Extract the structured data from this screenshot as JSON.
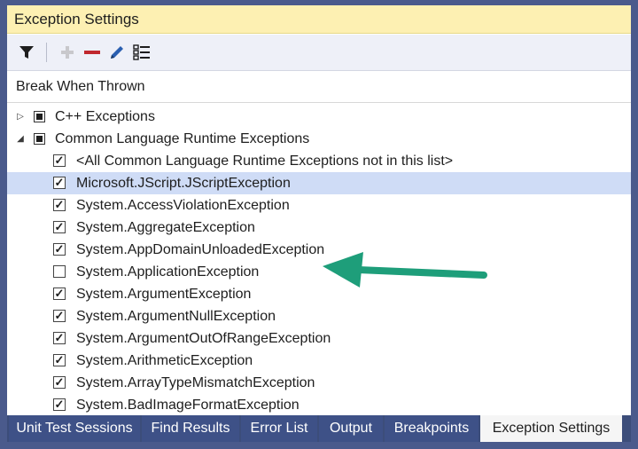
{
  "window": {
    "title": "Exception Settings"
  },
  "toolbar": {
    "buttons": [
      {
        "icon": "filter-icon"
      },
      {
        "icon": "add-icon"
      },
      {
        "icon": "remove-icon"
      },
      {
        "icon": "edit-icon"
      },
      {
        "icon": "restore-list-icon"
      }
    ]
  },
  "header": {
    "column": "Break When Thrown"
  },
  "tree": {
    "categories": [
      {
        "label": "C++ Exceptions",
        "expanded": false
      },
      {
        "label": "Common Language Runtime Exceptions",
        "expanded": true
      }
    ],
    "items": [
      {
        "label": "<All Common Language Runtime Exceptions not in this list>",
        "checked": true,
        "selected": false
      },
      {
        "label": "Microsoft.JScript.JScriptException",
        "checked": true,
        "selected": true
      },
      {
        "label": "System.AccessViolationException",
        "checked": true,
        "selected": false
      },
      {
        "label": "System.AggregateException",
        "checked": true,
        "selected": false
      },
      {
        "label": "System.AppDomainUnloadedException",
        "checked": true,
        "selected": false
      },
      {
        "label": "System.ApplicationException",
        "checked": false,
        "selected": false
      },
      {
        "label": "System.ArgumentException",
        "checked": true,
        "selected": false
      },
      {
        "label": "System.ArgumentNullException",
        "checked": true,
        "selected": false
      },
      {
        "label": "System.ArgumentOutOfRangeException",
        "checked": true,
        "selected": false
      },
      {
        "label": "System.ArithmeticException",
        "checked": true,
        "selected": false
      },
      {
        "label": "System.ArrayTypeMismatchException",
        "checked": true,
        "selected": false
      },
      {
        "label": "System.BadImageFormatException",
        "checked": true,
        "selected": false
      }
    ]
  },
  "tabs": [
    {
      "label": "Unit Test Sessions",
      "active": false
    },
    {
      "label": "Find Results",
      "active": false
    },
    {
      "label": "Error List",
      "active": false
    },
    {
      "label": "Output",
      "active": false
    },
    {
      "label": "Breakpoints",
      "active": false
    },
    {
      "label": "Exception Settings",
      "active": true
    }
  ],
  "colors": {
    "title_bar": "#fdf0b2",
    "selection": "#cfdcf6",
    "tab_strip": "#3e5187",
    "annotation_arrow": "#1e9e7a",
    "remove_icon": "#c0282e",
    "edit_icon": "#2a5fb0"
  }
}
